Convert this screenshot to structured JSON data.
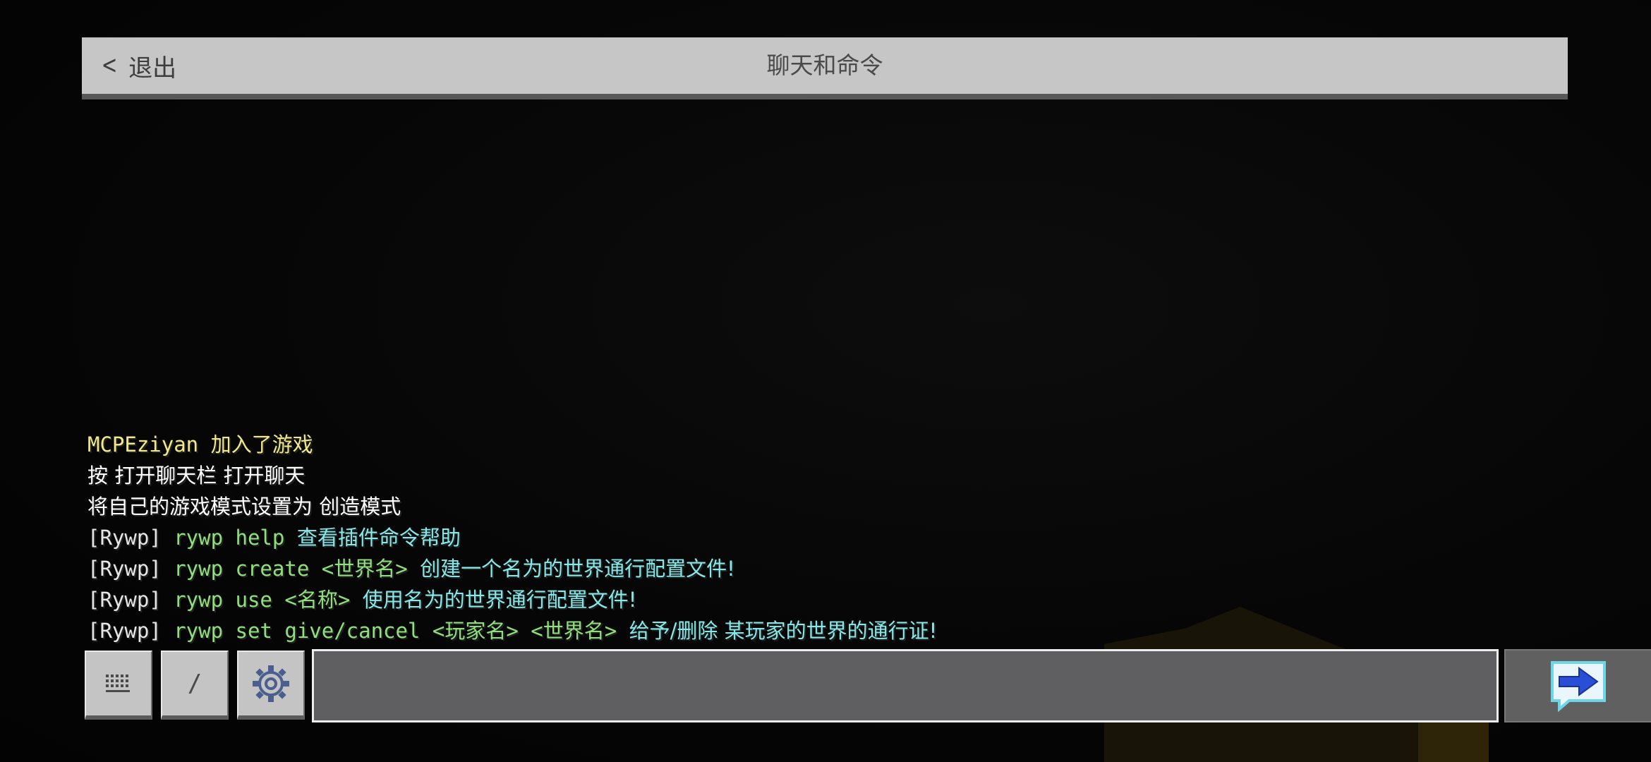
{
  "header": {
    "back_label": "退出",
    "title": "聊天和命令"
  },
  "chat": [
    {
      "segments": [
        {
          "text": "MCPEziyan ",
          "color": "yellow"
        },
        {
          "text": "加入了游戏",
          "color": "yellow",
          "cn": true
        }
      ]
    },
    {
      "segments": [
        {
          "text": "按 打开聊天栏 打开聊天",
          "color": "white",
          "cn": true
        }
      ]
    },
    {
      "segments": [
        {
          "text": "将自己的游戏模式设置为 创造模式",
          "color": "white",
          "cn": true
        }
      ]
    },
    {
      "segments": [
        {
          "text": "[Rywp] ",
          "color": "gray"
        },
        {
          "text": "rywp help ",
          "color": "green"
        },
        {
          "text": "查看插件命令帮助",
          "color": "cyan",
          "cn": true
        }
      ]
    },
    {
      "segments": [
        {
          "text": "[Rywp] ",
          "color": "gray"
        },
        {
          "text": "rywp create <世界名> ",
          "color": "green"
        },
        {
          "text": "创建一个名为的世界通行配置文件!",
          "color": "cyan",
          "cn": true
        }
      ]
    },
    {
      "segments": [
        {
          "text": "[Rywp] ",
          "color": "gray"
        },
        {
          "text": "rywp use <名称> ",
          "color": "green"
        },
        {
          "text": "使用名为的世界通行配置文件!",
          "color": "cyan",
          "cn": true
        }
      ]
    },
    {
      "segments": [
        {
          "text": "[Rywp] ",
          "color": "gray"
        },
        {
          "text": "rywp set give/cancel <玩家名> <世界名> ",
          "color": "green"
        },
        {
          "text": "给予/删除 某玩家的世界的通行证!",
          "color": "cyan",
          "cn": true
        }
      ]
    }
  ],
  "toolbar": {
    "keyboard_icon": "keyboard-icon",
    "slash_label": "/",
    "settings_icon": "gear-icon",
    "input_value": "",
    "input_placeholder": "",
    "send_icon": "send-arrow-icon"
  },
  "colors": {
    "header_bg": "#c6c6c6",
    "input_bg": "#5f5e61",
    "send_arrow": "#2a4fd6",
    "send_bubble": "#6fd6e8"
  }
}
